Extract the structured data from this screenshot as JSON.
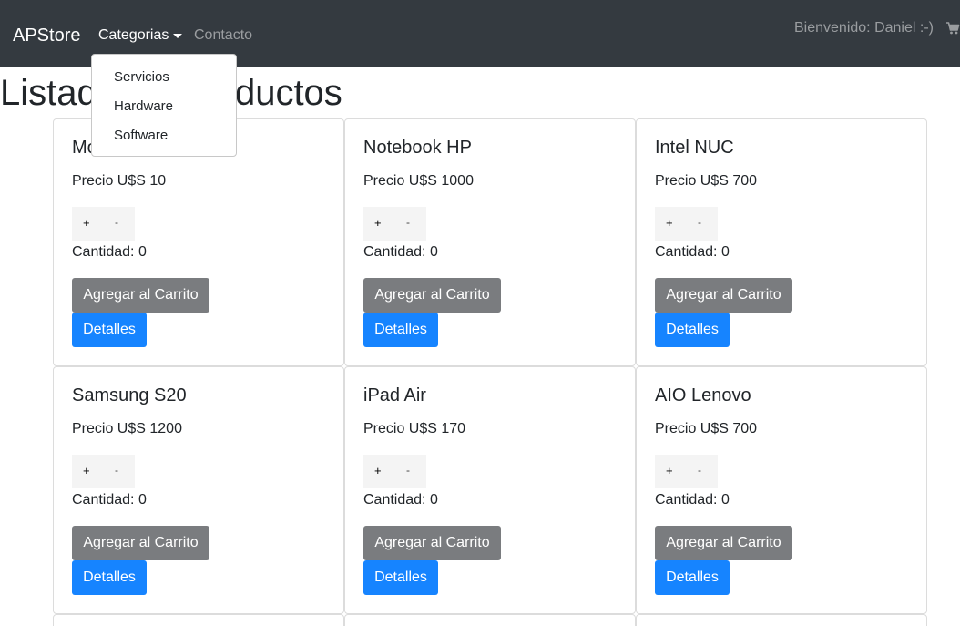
{
  "navbar": {
    "brand": "APStore",
    "categories_label": "Categorias",
    "contact_label": "Contacto",
    "welcome_text": "Bienvenido: Daniel :-)",
    "cart_icon": "shopping-cart-icon"
  },
  "dropdown": {
    "items": [
      "Servicios",
      "Hardware",
      "Software"
    ]
  },
  "page": {
    "title": "Listado de Productos"
  },
  "products": [
    {
      "name": "Monitor",
      "price": "Precio U$S 10",
      "quantity": "Cantidad: 0"
    },
    {
      "name": "Notebook HP",
      "price": "Precio U$S 1000",
      "quantity": "Cantidad: 0"
    },
    {
      "name": "Intel NUC",
      "price": "Precio U$S 700",
      "quantity": "Cantidad: 0"
    },
    {
      "name": "Samsung S20",
      "price": "Precio U$S 1200",
      "quantity": "Cantidad: 0"
    },
    {
      "name": "iPad Air",
      "price": "Precio U$S 170",
      "quantity": "Cantidad: 0"
    },
    {
      "name": "AIO Lenovo",
      "price": "Precio U$S 700",
      "quantity": "Cantidad: 0"
    }
  ],
  "card_labels": {
    "plus": "+",
    "minus": "-",
    "add_to_cart": "Agregar al Carrito",
    "details": "Detalles"
  },
  "colors": {
    "navbar_bg": "#343a40",
    "cart_button": "#7a7c7f",
    "details_button": "#1684ff"
  }
}
